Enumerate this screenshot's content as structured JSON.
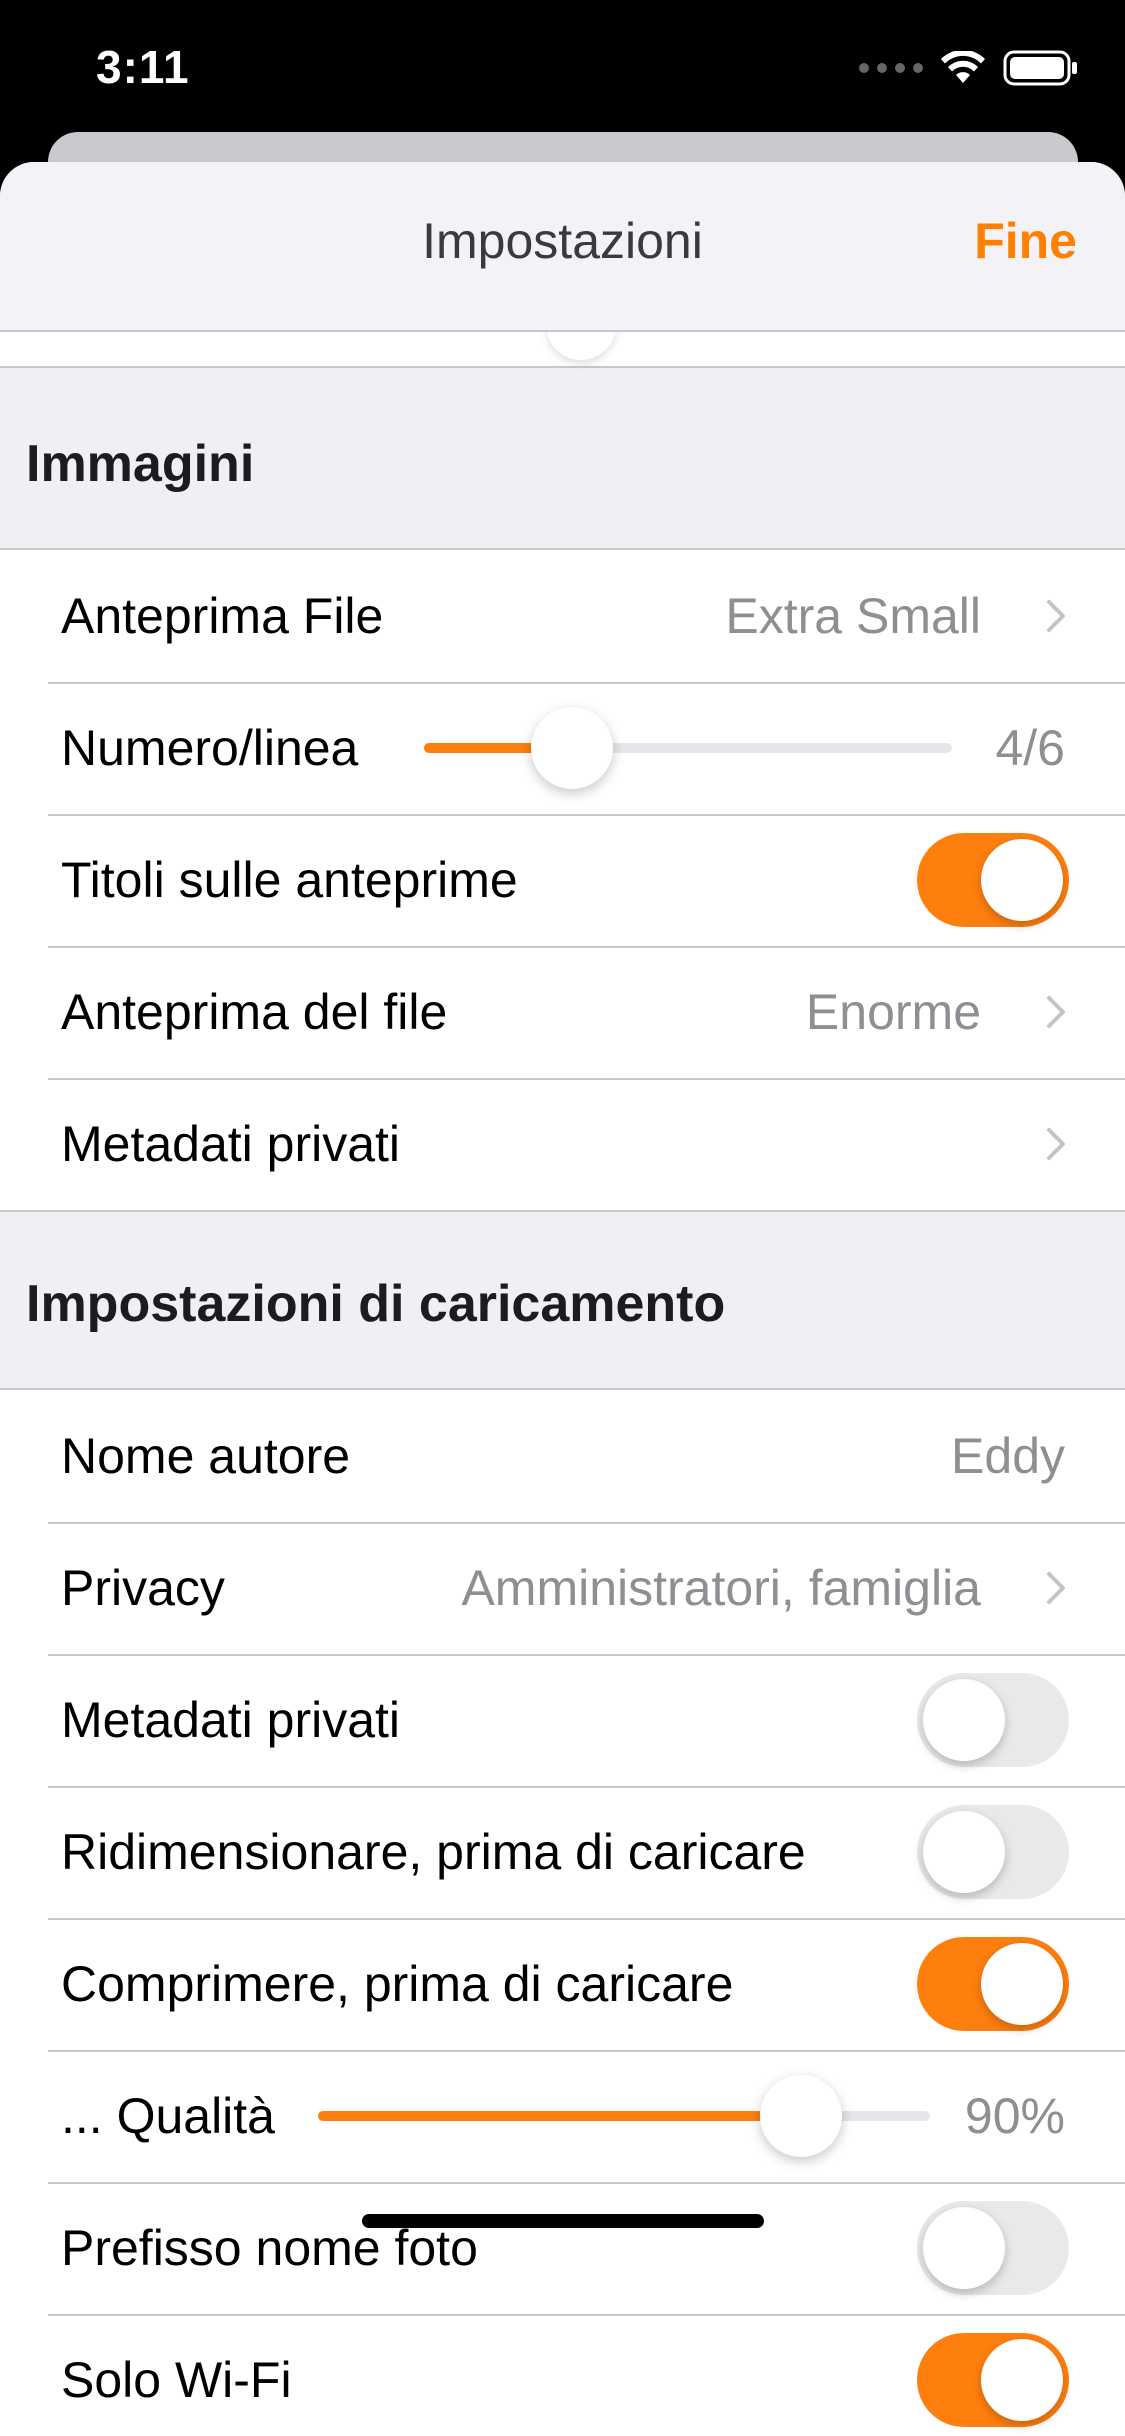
{
  "status_bar": {
    "time": "3:11",
    "wifi_icon": "wifi-icon",
    "battery_icon": "battery-icon"
  },
  "nav": {
    "title": "Impostazioni",
    "done_label": "Fine"
  },
  "colors": {
    "accent": "#ff7f0e",
    "toggle_off": "#e9e9eb",
    "secondary_text": "#8e8e93",
    "grouped_background": "#efeff4"
  },
  "images_section": {
    "header": "Immagini",
    "thumbnail_label": "Anteprima File",
    "thumbnail_value": "Extra Small",
    "per_row_label": "Numero/linea",
    "per_row_value": "4/6",
    "per_row_slider_fraction": 0.28,
    "titles_label": "Titoli sulle anteprime",
    "titles_on": true,
    "preview_label": "Anteprima del file",
    "preview_value": "Enorme",
    "private_metadata_label": "Metadati privati"
  },
  "upload_section": {
    "header": "Impostazioni di caricamento",
    "author_label": "Nome autore",
    "author_value": "Eddy",
    "privacy_label": "Privacy",
    "privacy_value": "Amministratori, famiglia",
    "strip_metadata_label": "Metadati privati",
    "strip_metadata_on": false,
    "resize_label": "Ridimensionare, prima di caricare",
    "resize_on": false,
    "compress_label": "Comprimere, prima di caricare",
    "compress_on": true,
    "quality_label": "... Qualità",
    "quality_value": "90%",
    "quality_slider_fraction": 0.79,
    "prefix_label": "Prefisso nome foto",
    "prefix_on": false,
    "wifi_only_label": "Solo Wi-Fi",
    "wifi_only_on": true
  }
}
